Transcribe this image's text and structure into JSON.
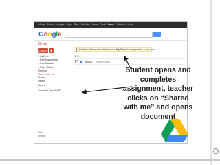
{
  "gbar": {
    "items": [
      "+Kaite",
      "Search",
      "Images",
      "Maps",
      "Play",
      "YouTube",
      "News",
      "Gmail",
      "Drive",
      "Calendar",
      "More"
    ]
  },
  "logo": {
    "text": "Google"
  },
  "drive": {
    "title": "Drive"
  },
  "create": {
    "label": "CREATE"
  },
  "banner": {
    "text": "Add files or folders shared with you to",
    "strong": "My Drive",
    "rest": "for easy access.",
    "link": "Learn more"
  },
  "sidebar": {
    "items": [
      "▾ My Drive",
      "  ▸ Tech Assignments",
      "  ▾ Tech Classes",
      "    ▾ Fourth Grade",
      "      Report 4",
      "Shared with me",
      "Starred",
      "Recent",
      "More ▾"
    ],
    "download": "Download Drive for PC"
  },
  "list": {
    "label": "WEEK",
    "rows": [
      {
        "name": "Report 4",
        "owner": "Jennifer Smith"
      }
    ]
  },
  "bottom": {
    "lines": [
      "0% in",
      "Storage"
    ]
  },
  "callout": {
    "text": "Student opens and completes assignment, teacher clicks on “Shared with me” and opens document"
  },
  "colors": {
    "accent_red": "#d14836",
    "banner_yellow": "#fff9db",
    "gbar": "#2d2d2d"
  },
  "icons": [
    "upload-icon",
    "google-drive-logo",
    "arrow-icon"
  ]
}
